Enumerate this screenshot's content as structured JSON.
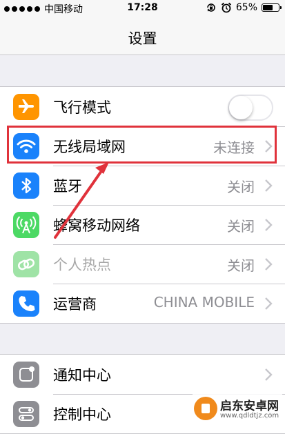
{
  "status_bar": {
    "carrier": "中国移动",
    "time": "17:28",
    "battery_percent": "65%",
    "battery_level": 0.65,
    "icons": [
      "signal-dots-icon",
      "wifi-off",
      "orientation-lock-icon",
      "alarm-icon",
      "battery-icon"
    ]
  },
  "nav": {
    "title": "设置"
  },
  "colors": {
    "airplane": "#ff9500",
    "wifi": "#1a82fb",
    "bluetooth": "#1a82fb",
    "cellular": "#4cd964",
    "hotspot": "#9fe3a6",
    "carrier": "#1a82fb",
    "notification": "#8e8e93",
    "control_center": "#8e8e93",
    "highlight": "#e0323b"
  },
  "settings": {
    "airplane": {
      "label": "飞行模式",
      "icon": "airplane-icon",
      "toggle_on": false
    },
    "wifi": {
      "label": "无线局域网",
      "value": "未连接",
      "icon": "wifi-icon"
    },
    "bluetooth": {
      "label": "蓝牙",
      "value": "关闭",
      "icon": "bluetooth-icon"
    },
    "cellular": {
      "label": "蜂窝移动网络",
      "value": "关闭",
      "icon": "cellular-antenna-icon"
    },
    "hotspot": {
      "label": "个人热点",
      "value": "关闭",
      "icon": "hotspot-link-icon"
    },
    "carrier": {
      "label": "运营商",
      "value": "CHINA MOBILE",
      "icon": "phone-icon"
    },
    "notification_center": {
      "label": "通知中心",
      "icon": "notification-center-icon"
    },
    "control_center": {
      "label": "控制中心",
      "icon": "control-center-icon"
    }
  },
  "watermark": {
    "title": "启东安卓网",
    "url": "www.qdldtjz.com"
  }
}
